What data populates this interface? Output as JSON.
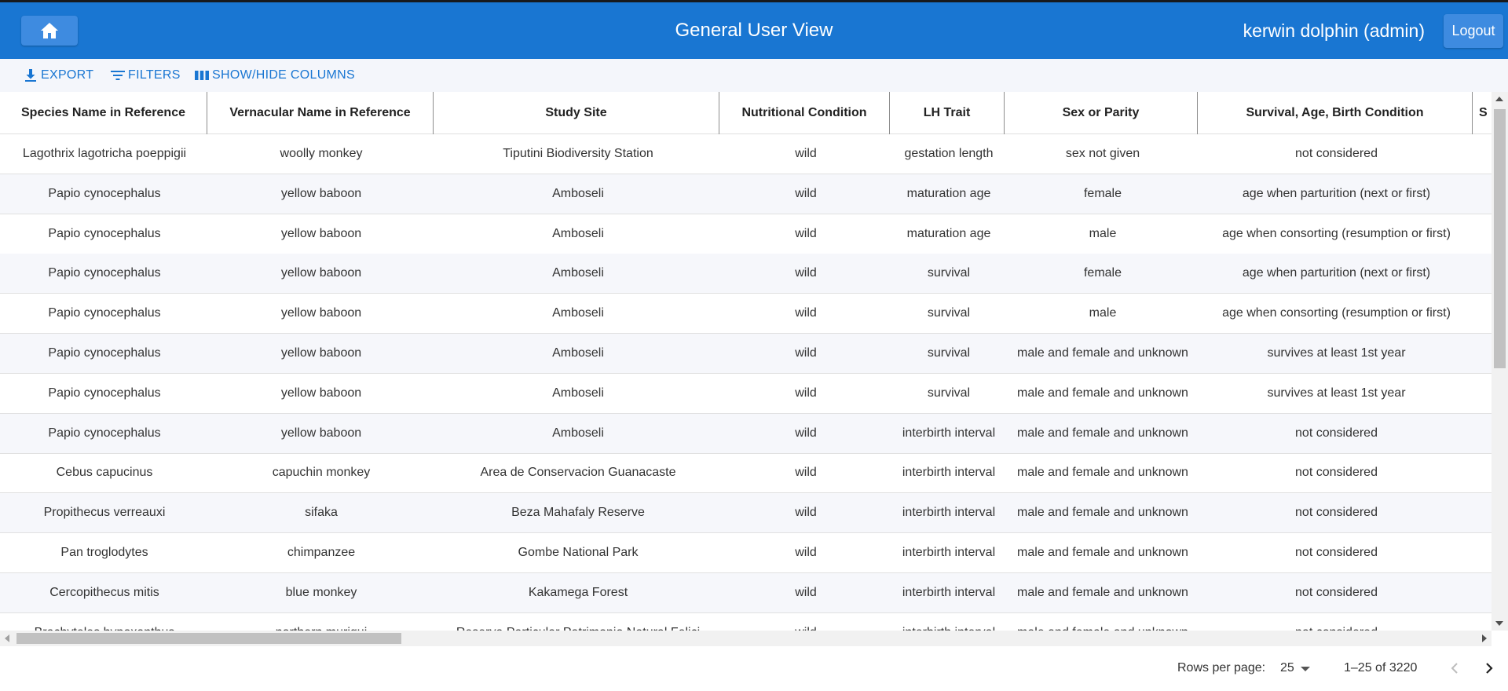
{
  "header": {
    "home_icon": "home-icon",
    "title": "General User View",
    "user": "kerwin dolphin (admin)",
    "logout_label": "Logout",
    "color": "#1976d2"
  },
  "toolbar": {
    "export_label": "EXPORT",
    "filters_label": "FILTERS",
    "columns_label": "SHOW/HIDE COLUMNS",
    "accent": "#1976d2"
  },
  "grid": {
    "columns": [
      "Species Name in Reference",
      "Vernacular Name in Reference",
      "Study Site",
      "Nutritional Condition",
      "LH Trait",
      "Sex or Parity",
      "Survival, Age, Birth Condition",
      "S"
    ],
    "rows": [
      [
        "Lagothrix lagotricha poeppigii",
        "woolly monkey",
        "Tiputini Biodiversity Station",
        "wild",
        "gestation length",
        "sex not given",
        "not considered"
      ],
      [
        "Papio cynocephalus",
        "yellow baboon",
        "Amboseli",
        "wild",
        "maturation age",
        "female",
        "age when parturition (next or first)"
      ],
      [
        "Papio cynocephalus",
        "yellow baboon",
        "Amboseli",
        "wild",
        "maturation age",
        "male",
        "age when consorting (resumption or first)"
      ],
      [
        "Papio cynocephalus",
        "yellow baboon",
        "Amboseli",
        "wild",
        "survival",
        "female",
        "age when parturition (next or first)"
      ],
      [
        "Papio cynocephalus",
        "yellow baboon",
        "Amboseli",
        "wild",
        "survival",
        "male",
        "age when consorting (resumption or first)"
      ],
      [
        "Papio cynocephalus",
        "yellow baboon",
        "Amboseli",
        "wild",
        "survival",
        "male and female and unknown",
        "survives at least 1st year"
      ],
      [
        "Papio cynocephalus",
        "yellow baboon",
        "Amboseli",
        "wild",
        "survival",
        "male and female and unknown",
        "survives at least 1st year"
      ],
      [
        "Papio cynocephalus",
        "yellow baboon",
        "Amboseli",
        "wild",
        "interbirth interval",
        "male and female and unknown",
        "not considered"
      ],
      [
        "Cebus capucinus",
        "capuchin monkey",
        "Area de Conservacion Guanacaste",
        "wild",
        "interbirth interval",
        "male and female and unknown",
        "not considered"
      ],
      [
        "Propithecus verreauxi",
        "sifaka",
        "Beza Mahafaly Reserve",
        "wild",
        "interbirth interval",
        "male and female and unknown",
        "not considered"
      ],
      [
        "Pan troglodytes",
        "chimpanzee",
        "Gombe National Park",
        "wild",
        "interbirth interval",
        "male and female and unknown",
        "not considered"
      ],
      [
        "Cercopithecus mitis",
        "blue monkey",
        "Kakamega Forest",
        "wild",
        "interbirth interval",
        "male and female and unknown",
        "not considered"
      ],
      [
        "Brachyteles hypoxanthus",
        "northern muriqui",
        "Reserva Particular Patrimonio Natural Felici",
        "wild",
        "interbirth interval",
        "male and female and unknown",
        "not considered"
      ]
    ]
  },
  "pagination": {
    "rows_per_page_label": "Rows per page:",
    "rows_per_page": "25",
    "range": "1–25 of 3220"
  }
}
